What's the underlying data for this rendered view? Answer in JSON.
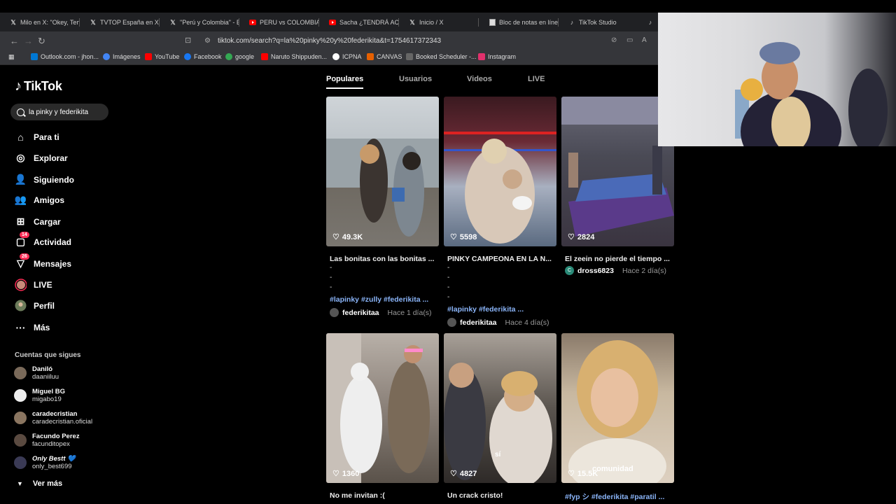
{
  "browser": {
    "tabs": [
      {
        "label": "Milo en X: \"Okey, Teng",
        "icon": "x-icon"
      },
      {
        "label": "TVTOP España en X: \"",
        "icon": "x-icon"
      },
      {
        "label": "\"Perú y Colombia\" - B",
        "icon": "x-icon"
      },
      {
        "label": "PERU vs COLOMBIA in",
        "icon": "youtube-icon"
      },
      {
        "label": "Sacha ¿TENDRÁ AC",
        "icon": "youtube-icon"
      },
      {
        "label": "Inicio / X",
        "icon": "x-icon"
      },
      {
        "label": "Bloc de notas en líne",
        "icon": "notepad-icon"
      },
      {
        "label": "TikTok Studio",
        "icon": "tiktok-icon"
      }
    ],
    "url": "tiktok.com/search?q=la%20pinky%20y%20federikita&t=1754617372343",
    "bookmarks": [
      {
        "label": "Outlook.com - jhon...",
        "color": "#0078d4"
      },
      {
        "label": "Imágenes",
        "color": "#4285f4"
      },
      {
        "label": "YouTube",
        "color": "#ff0000"
      },
      {
        "label": "Facebook",
        "color": "#1877f2"
      },
      {
        "label": "google",
        "color": "#34a853"
      },
      {
        "label": "Naruto Shippuden...",
        "color": "#ff0000"
      },
      {
        "label": "ICPNA",
        "color": "#ffffff"
      },
      {
        "label": "CANVAS",
        "color": "#e66000"
      },
      {
        "label": "Booked Scheduler -...",
        "color": "#666666"
      },
      {
        "label": "Instagram",
        "color": "#e1306c"
      }
    ]
  },
  "sidebar": {
    "logo": "TikTok",
    "search_value": "la pinky y federikita",
    "nav": [
      {
        "label": "Para ti",
        "icon": "home-icon"
      },
      {
        "label": "Explorar",
        "icon": "compass-icon"
      },
      {
        "label": "Siguiendo",
        "icon": "following-icon"
      },
      {
        "label": "Amigos",
        "icon": "friends-icon"
      },
      {
        "label": "Cargar",
        "icon": "upload-icon"
      },
      {
        "label": "Actividad",
        "icon": "activity-icon",
        "badge": "14"
      },
      {
        "label": "Mensajes",
        "icon": "messages-icon",
        "badge": "26"
      },
      {
        "label": "LIVE",
        "icon": "live-icon"
      },
      {
        "label": "Perfil",
        "icon": "profile-icon"
      },
      {
        "label": "Más",
        "icon": "more-icon"
      }
    ],
    "following_title": "Cuentas que sigues",
    "following": [
      {
        "name": "Daniló",
        "handle": "daaniiluu"
      },
      {
        "name": "Miguel BG",
        "handle": "migabo19"
      },
      {
        "name": "caradecristian",
        "handle": "caradecristian.oficial"
      },
      {
        "name": "Facundo Perez",
        "handle": "facunditopex"
      },
      {
        "name": "Only Bestt 💙",
        "handle": "only_best699"
      }
    ],
    "see_more": "Ver más"
  },
  "search_tabs": [
    "Populares",
    "Usuarios",
    "Videos",
    "LIVE"
  ],
  "videos": [
    {
      "likes": "49.3K",
      "caption": "Las bonitas con las bonitas ...",
      "dashes": [
        "-",
        "-",
        "-"
      ],
      "tags": "#lapinky #zully #federikita ...",
      "author": "federikitaa",
      "date": "Hace 1 día(s)"
    },
    {
      "likes": "5598",
      "caption": "PINKY CAMPEONA EN LA N...",
      "dashes": [
        "-",
        "-",
        "-",
        "-"
      ],
      "tags": "#lapinky #federikita ...",
      "author": "federikitaa",
      "date": "Hace 4 día(s)"
    },
    {
      "likes": "2824",
      "caption": "El zeein no pierde el tiempo ...",
      "dashes": [],
      "tags": "",
      "author": "dross6823",
      "date": "Hace 2 día(s)"
    },
    {
      "likes": "1360",
      "caption": "No me invitan :(",
      "dashes": [],
      "tags": "",
      "author": "",
      "date": ""
    },
    {
      "likes": "4827",
      "caption": "Un crack cristo!",
      "dashes": [],
      "tags": "",
      "author": "",
      "date": ""
    },
    {
      "likes": "15.5K",
      "caption": "#fyp シ #federikita #paratil ...",
      "dashes": [],
      "tags": "",
      "author": "",
      "date": ""
    }
  ],
  "overlay_texts": {
    "v5": "sí",
    "v6": "comunidad"
  }
}
